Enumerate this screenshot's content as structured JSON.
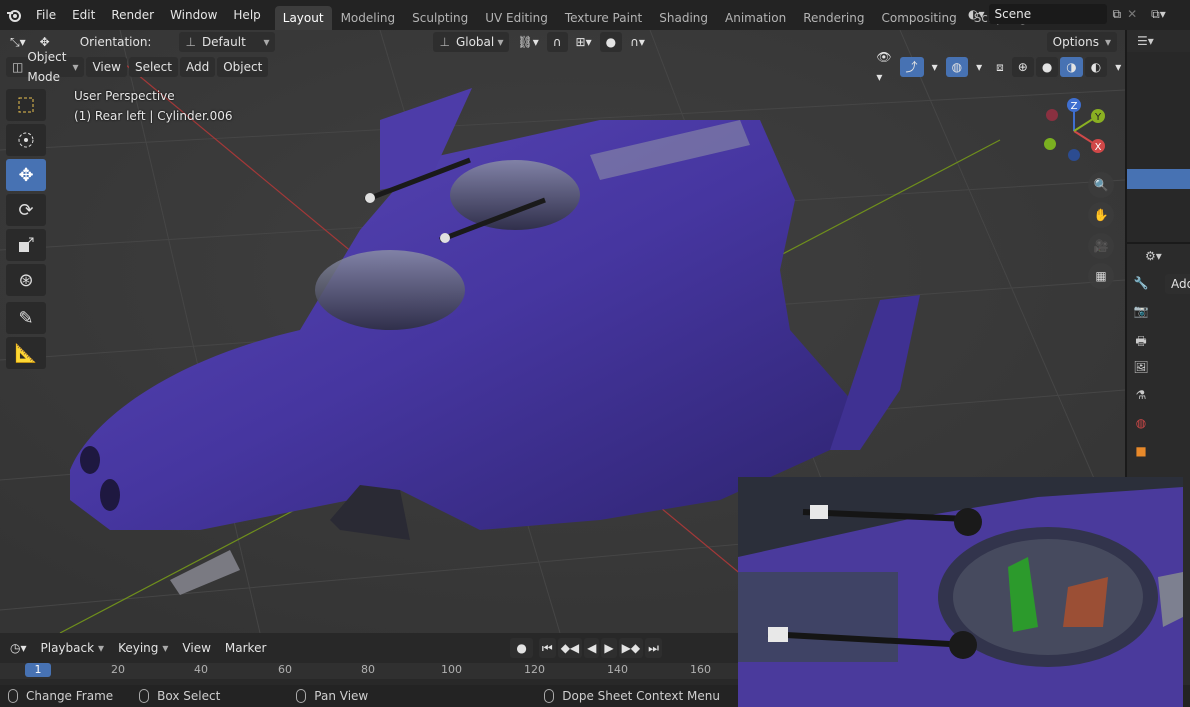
{
  "menu": [
    "File",
    "Edit",
    "Render",
    "Window",
    "Help"
  ],
  "workspaces": [
    "Layout",
    "Modeling",
    "Sculpting",
    "UV Editing",
    "Texture Paint",
    "Shading",
    "Animation",
    "Rendering",
    "Compositing",
    "Scripting"
  ],
  "scene": {
    "label": "Scene"
  },
  "header1": {
    "orientation_label": "Orientation:",
    "orientation_value": "Default",
    "transform_space": "Global",
    "options": "Options"
  },
  "header2": {
    "mode": "Object Mode",
    "view": "View",
    "select": "Select",
    "add": "Add",
    "object": "Object"
  },
  "overlay": {
    "perspective": "User Perspective",
    "object_info": "(1) Rear left | Cylinder.006"
  },
  "gizmo": {
    "z": "Z",
    "y": "Y",
    "x": "X"
  },
  "right_panel": {
    "add": "Add"
  },
  "timeline": {
    "playback": "Playback",
    "keying": "Keying",
    "view": "View",
    "marker": "Marker",
    "current_frame": "1",
    "ticks": [
      "20",
      "40",
      "60",
      "80",
      "100",
      "120",
      "140",
      "160"
    ]
  },
  "status": {
    "change_frame": "Change Frame",
    "box_select": "Box Select",
    "pan_view": "Pan View",
    "context_menu": "Dope Sheet Context Menu"
  },
  "colors": {
    "accent": "#4772b3",
    "ship": "#4a3a9c",
    "axis_x": "#b03030",
    "axis_y": "#7a9a20"
  }
}
